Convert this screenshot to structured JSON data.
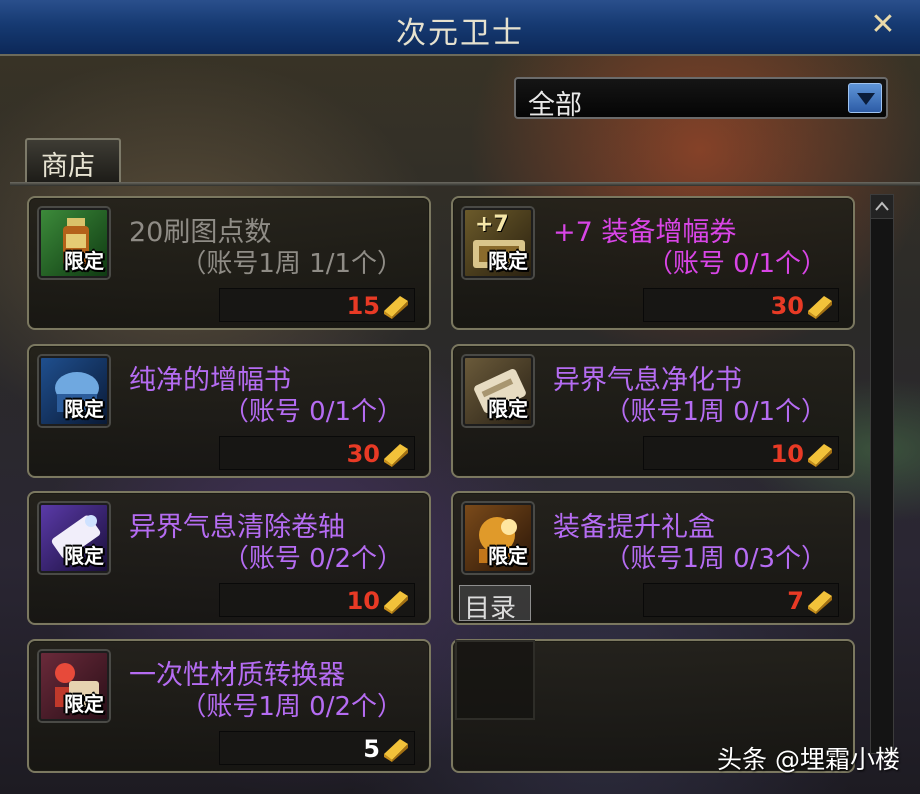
{
  "window": {
    "title": "次元卫士",
    "close_label": "✕"
  },
  "filter": {
    "selected": "全部"
  },
  "tabs": [
    {
      "label": "商店"
    }
  ],
  "colors": {
    "gray_text": "#8f8c86",
    "magenta_text": "#d845e6",
    "purple_text": "#b56cf2",
    "price_red": "#e83a25",
    "price_white": "#ffffff"
  },
  "items": [
    {
      "name": "20刷图点数",
      "limit": "（账号1周 1/1个）",
      "price": "15",
      "badge": "限定",
      "icon": "potion-bottle-icon",
      "name_color": "gray",
      "price_color": "red"
    },
    {
      "name": "+7 装备增幅券",
      "limit": "（账号 0/1个）",
      "price": "30",
      "badge": "限定",
      "icon": "plus7-ticket-icon",
      "icon_text": "+7",
      "name_color": "magenta",
      "price_color": "red"
    },
    {
      "name": "纯净的增幅书",
      "limit": "（账号 0/1个）",
      "price": "30",
      "badge": "限定",
      "icon": "blue-book-icon",
      "name_color": "purple",
      "price_color": "red"
    },
    {
      "name": "异界气息净化书",
      "limit": "（账号1周 0/1个）",
      "price": "10",
      "badge": "限定",
      "icon": "scroll-paper-icon",
      "name_color": "purple",
      "price_color": "red"
    },
    {
      "name": "异界气息清除卷轴",
      "limit": "（账号 0/2个）",
      "price": "10",
      "badge": "限定",
      "icon": "purple-scroll-icon",
      "name_color": "purple",
      "price_color": "red"
    },
    {
      "name": "装备提升礼盒",
      "limit": "（账号1周 0/3个）",
      "price": "7",
      "badge": "限定",
      "icon": "gift-box-icon",
      "name_color": "purple",
      "price_color": "red"
    },
    {
      "name": "一次性材质转换器",
      "limit": "（账号1周 0/2个）",
      "price": "5",
      "badge": "限定",
      "icon": "material-converter-icon",
      "name_color": "purple",
      "price_color": "white"
    }
  ],
  "tooltip": {
    "label": "目录"
  },
  "watermark": "头条 @埋霜小楼"
}
